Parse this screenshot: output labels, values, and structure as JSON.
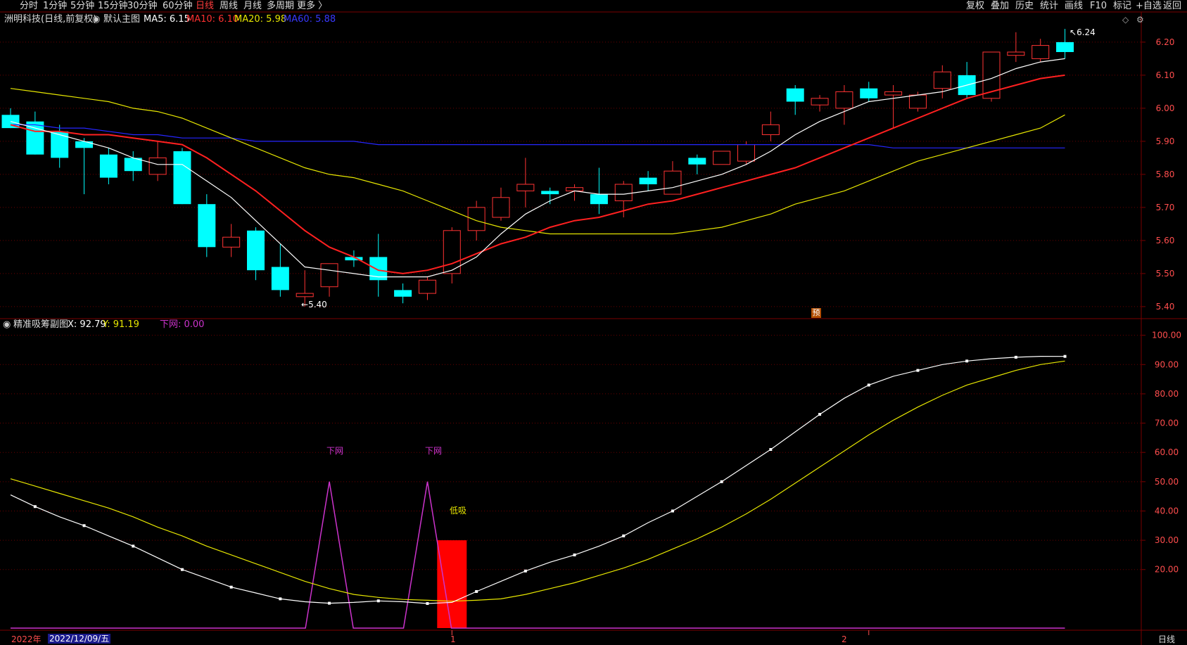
{
  "toolbar": {
    "left_items": [
      "分时",
      "1分钟",
      "5分钟",
      "15分钟",
      "30分钟",
      "60分钟",
      "日线",
      "周线",
      "月线",
      "多周期",
      "更多 〉"
    ],
    "active": "日线",
    "right_items": [
      "复权",
      "叠加",
      "历史",
      "统计",
      "画线",
      "F10",
      "标记",
      "+自选",
      "返回"
    ]
  },
  "main_panel": {
    "stock_label": "洲明科技(日线,前复权)",
    "chart_name": "默认主图",
    "ma5": "MA5: 6.15",
    "ma10": "MA10: 6.10",
    "ma20": "MA20: 5.98",
    "ma60": "MA60: 5.88",
    "high_marker": "6.24",
    "low_marker": "5.40",
    "forecast_badge": "预",
    "top_right_icons": [
      "diamond-icon",
      "settings-icon"
    ]
  },
  "sub_panel": {
    "title": "精准吸筹副图",
    "x_value": "X: 92.79",
    "y_value": "Y: 91.19",
    "net_value": "下网: 0.00",
    "label_xiawang": "下网",
    "label_dixi": "低吸"
  },
  "date_bar": {
    "year": "2022年",
    "cursor_date": "2022/12/09/五",
    "month_ticks": [
      "1",
      "2"
    ],
    "period_button": "日线"
  },
  "colors": {
    "up": "#ff3333",
    "down": "#00ffff",
    "ma5": "#ffffff",
    "ma10": "#ff2020",
    "ma20": "#e6e600",
    "ma60": "#2626ff",
    "sub_x": "#ffffff",
    "sub_y": "#e6e600",
    "sub_signal": "#cc33cc",
    "grid": "#6b0000",
    "axis_text": "#ff4d4d"
  },
  "chart_data": [
    {
      "type": "candlestick",
      "title": "洲明科技(日线,前复权)",
      "y_ticks": [
        5.4,
        5.5,
        5.6,
        5.7,
        5.8,
        5.9,
        6.0,
        6.1,
        6.2
      ],
      "ylim": [
        5.37,
        6.27
      ],
      "candles": [
        {
          "o": 5.98,
          "h": 6.0,
          "l": 5.94,
          "c": 5.94
        },
        {
          "o": 5.96,
          "h": 5.99,
          "l": 5.86,
          "c": 5.86
        },
        {
          "o": 5.93,
          "h": 5.95,
          "l": 5.82,
          "c": 5.85
        },
        {
          "o": 5.9,
          "h": 5.91,
          "l": 5.74,
          "c": 5.88
        },
        {
          "o": 5.86,
          "h": 5.88,
          "l": 5.77,
          "c": 5.79
        },
        {
          "o": 5.85,
          "h": 5.87,
          "l": 5.78,
          "c": 5.81
        },
        {
          "o": 5.8,
          "h": 5.9,
          "l": 5.78,
          "c": 5.85
        },
        {
          "o": 5.87,
          "h": 5.88,
          "l": 5.71,
          "c": 5.71
        },
        {
          "o": 5.71,
          "h": 5.74,
          "l": 5.55,
          "c": 5.58
        },
        {
          "o": 5.58,
          "h": 5.65,
          "l": 5.55,
          "c": 5.61
        },
        {
          "o": 5.63,
          "h": 5.64,
          "l": 5.48,
          "c": 5.51
        },
        {
          "o": 5.52,
          "h": 5.59,
          "l": 5.43,
          "c": 5.45
        },
        {
          "o": 5.43,
          "h": 5.51,
          "l": 5.4,
          "c": 5.44
        },
        {
          "o": 5.46,
          "h": 5.53,
          "l": 5.43,
          "c": 5.53
        },
        {
          "o": 5.55,
          "h": 5.57,
          "l": 5.52,
          "c": 5.54
        },
        {
          "o": 5.55,
          "h": 5.62,
          "l": 5.43,
          "c": 5.48
        },
        {
          "o": 5.45,
          "h": 5.47,
          "l": 5.41,
          "c": 5.43
        },
        {
          "o": 5.44,
          "h": 5.49,
          "l": 5.42,
          "c": 5.48
        },
        {
          "o": 5.5,
          "h": 5.64,
          "l": 5.47,
          "c": 5.63
        },
        {
          "o": 5.63,
          "h": 5.72,
          "l": 5.6,
          "c": 5.7
        },
        {
          "o": 5.67,
          "h": 5.76,
          "l": 5.66,
          "c": 5.73
        },
        {
          "o": 5.75,
          "h": 5.85,
          "l": 5.7,
          "c": 5.77
        },
        {
          "o": 5.75,
          "h": 5.76,
          "l": 5.71,
          "c": 5.74
        },
        {
          "o": 5.75,
          "h": 5.77,
          "l": 5.72,
          "c": 5.76
        },
        {
          "o": 5.74,
          "h": 5.82,
          "l": 5.68,
          "c": 5.71
        },
        {
          "o": 5.72,
          "h": 5.78,
          "l": 5.67,
          "c": 5.77
        },
        {
          "o": 5.79,
          "h": 5.81,
          "l": 5.75,
          "c": 5.77
        },
        {
          "o": 5.74,
          "h": 5.84,
          "l": 5.74,
          "c": 5.81
        },
        {
          "o": 5.85,
          "h": 5.86,
          "l": 5.8,
          "c": 5.83
        },
        {
          "o": 5.83,
          "h": 5.87,
          "l": 5.83,
          "c": 5.87
        },
        {
          "o": 5.84,
          "h": 5.9,
          "l": 5.83,
          "c": 5.89
        },
        {
          "o": 5.92,
          "h": 5.99,
          "l": 5.9,
          "c": 5.95
        },
        {
          "o": 6.06,
          "h": 6.07,
          "l": 5.98,
          "c": 6.02
        },
        {
          "o": 6.01,
          "h": 6.04,
          "l": 5.99,
          "c": 6.03
        },
        {
          "o": 6.0,
          "h": 6.07,
          "l": 5.95,
          "c": 6.05
        },
        {
          "o": 6.06,
          "h": 6.08,
          "l": 6.02,
          "c": 6.03
        },
        {
          "o": 6.04,
          "h": 6.07,
          "l": 5.94,
          "c": 6.05
        },
        {
          "o": 6.0,
          "h": 6.05,
          "l": 5.99,
          "c": 6.04
        },
        {
          "o": 6.06,
          "h": 6.13,
          "l": 6.03,
          "c": 6.11
        },
        {
          "o": 6.1,
          "h": 6.14,
          "l": 6.03,
          "c": 6.04
        },
        {
          "o": 6.03,
          "h": 6.17,
          "l": 6.02,
          "c": 6.17
        },
        {
          "o": 6.16,
          "h": 6.23,
          "l": 6.14,
          "c": 6.17
        },
        {
          "o": 6.15,
          "h": 6.21,
          "l": 6.14,
          "c": 6.19
        },
        {
          "o": 6.2,
          "h": 6.24,
          "l": 6.15,
          "c": 6.17
        }
      ],
      "ma5": [
        5.96,
        5.94,
        5.92,
        5.9,
        5.88,
        5.85,
        5.83,
        5.83,
        5.78,
        5.73,
        5.66,
        5.59,
        5.52,
        5.51,
        5.5,
        5.49,
        5.49,
        5.49,
        5.51,
        5.55,
        5.62,
        5.68,
        5.72,
        5.75,
        5.74,
        5.74,
        5.75,
        5.76,
        5.78,
        5.8,
        5.83,
        5.87,
        5.92,
        5.96,
        5.99,
        6.02,
        6.03,
        6.04,
        6.05,
        6.07,
        6.09,
        6.12,
        6.14,
        6.15
      ],
      "ma10": [
        5.95,
        5.93,
        5.93,
        5.92,
        5.92,
        5.91,
        5.9,
        5.89,
        5.85,
        5.8,
        5.75,
        5.69,
        5.63,
        5.58,
        5.55,
        5.51,
        5.5,
        5.51,
        5.53,
        5.56,
        5.59,
        5.61,
        5.64,
        5.66,
        5.67,
        5.69,
        5.71,
        5.72,
        5.74,
        5.76,
        5.78,
        5.8,
        5.82,
        5.85,
        5.88,
        5.91,
        5.94,
        5.97,
        6.0,
        6.03,
        6.05,
        6.07,
        6.09,
        6.1
      ],
      "ma20": [
        6.06,
        6.05,
        6.04,
        6.03,
        6.02,
        6.0,
        5.99,
        5.97,
        5.94,
        5.91,
        5.88,
        5.85,
        5.82,
        5.8,
        5.79,
        5.77,
        5.75,
        5.72,
        5.69,
        5.66,
        5.64,
        5.63,
        5.62,
        5.62,
        5.62,
        5.62,
        5.62,
        5.62,
        5.63,
        5.64,
        5.66,
        5.68,
        5.71,
        5.73,
        5.75,
        5.78,
        5.81,
        5.84,
        5.86,
        5.88,
        5.9,
        5.92,
        5.94,
        5.98
      ],
      "ma60": [
        5.95,
        5.95,
        5.94,
        5.94,
        5.93,
        5.92,
        5.92,
        5.91,
        5.91,
        5.91,
        5.9,
        5.9,
        5.9,
        5.9,
        5.9,
        5.89,
        5.89,
        5.89,
        5.89,
        5.89,
        5.89,
        5.89,
        5.89,
        5.89,
        5.89,
        5.89,
        5.89,
        5.89,
        5.89,
        5.89,
        5.89,
        5.89,
        5.89,
        5.89,
        5.89,
        5.89,
        5.88,
        5.88,
        5.88,
        5.88,
        5.88,
        5.88,
        5.88,
        5.88
      ]
    },
    {
      "type": "line",
      "title": "精准吸筹副图",
      "y_ticks": [
        20,
        30,
        40,
        50,
        60,
        70,
        80,
        90,
        100
      ],
      "ylim": [
        0,
        104
      ],
      "series": [
        {
          "name": "X",
          "values": [
            45.5,
            41.5,
            38,
            35,
            31.5,
            28,
            24,
            20,
            17,
            14,
            12,
            10,
            9,
            8.5,
            8.8,
            9.3,
            9,
            8.4,
            8.8,
            12.5,
            16,
            19.5,
            22.5,
            25,
            28,
            31.5,
            36,
            40,
            45,
            50,
            55.5,
            61,
            67,
            73,
            78.5,
            83,
            86,
            88,
            90,
            91.2,
            92,
            92.5,
            92.8,
            92.79
          ]
        },
        {
          "name": "Y",
          "values": [
            51,
            48.5,
            46,
            43.5,
            41,
            38,
            34.5,
            31.5,
            28,
            25,
            22,
            19,
            16,
            13.5,
            11.5,
            10.5,
            9.8,
            9.5,
            9.2,
            9.5,
            10,
            11.5,
            13.5,
            15.5,
            18,
            20.5,
            23.5,
            27,
            30.5,
            34.5,
            39,
            44,
            49.5,
            55,
            60.5,
            66,
            71,
            75.5,
            79.5,
            83,
            85.5,
            88,
            90,
            91.19
          ]
        }
      ],
      "signal_spikes": [
        13,
        17
      ],
      "signal_value": 50,
      "bar": {
        "index": 18,
        "value": 30
      }
    }
  ]
}
